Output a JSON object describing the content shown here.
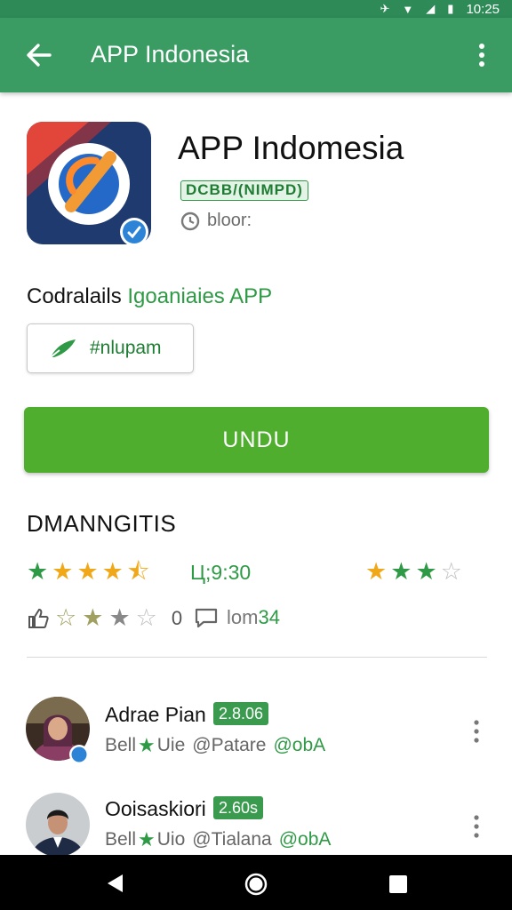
{
  "status_bar": {
    "time": "10:25"
  },
  "app_bar": {
    "title": "APP Indonesia"
  },
  "app": {
    "name": "APP Indomesia",
    "developer_tag": "DCBB/(NIMPD)",
    "meta_text": "bloor:"
  },
  "description": {
    "prefix": "Codralails",
    "accent": "Igoaniaies APP"
  },
  "chip": {
    "label": "#nlupam"
  },
  "install": {
    "label": "UNDU"
  },
  "ratings_section": {
    "title": "DMANNGITIS",
    "count": "Ц;9:30",
    "left_rating_fraction": 0.9,
    "right_rating_fraction": 0.6,
    "stat_count": "0",
    "comment_prefix": "lom",
    "comment_accent": "34"
  },
  "reviews": [
    {
      "name": "Adrae Pian",
      "score": "2.8.06",
      "meta_prefix": "Bell",
      "meta_mid": "Uie",
      "meta_place": "@Patare",
      "meta_accent": "@obA"
    },
    {
      "name": "Ooisaskiori",
      "score": "2.60s",
      "meta_prefix": "Bell",
      "meta_mid": "Uio",
      "meta_place": "@Tialana",
      "meta_accent": "@obA"
    }
  ],
  "colors": {
    "app_bar": "#3a9b63",
    "status_bar": "#2e8b57",
    "accent_green": "#2e9a45",
    "install_green": "#4fae2e",
    "star_gold": "#f0a818"
  },
  "icons": [
    "back-arrow-icon",
    "more-vert-icon",
    "app-logo-icon",
    "verified-badge-icon",
    "clock-icon",
    "pencil-icon",
    "star-icon",
    "thumbs-up-icon",
    "comment-icon",
    "wifi-icon",
    "signal-icon",
    "battery-icon",
    "nav-back-icon",
    "nav-home-icon",
    "nav-recent-icon"
  ]
}
